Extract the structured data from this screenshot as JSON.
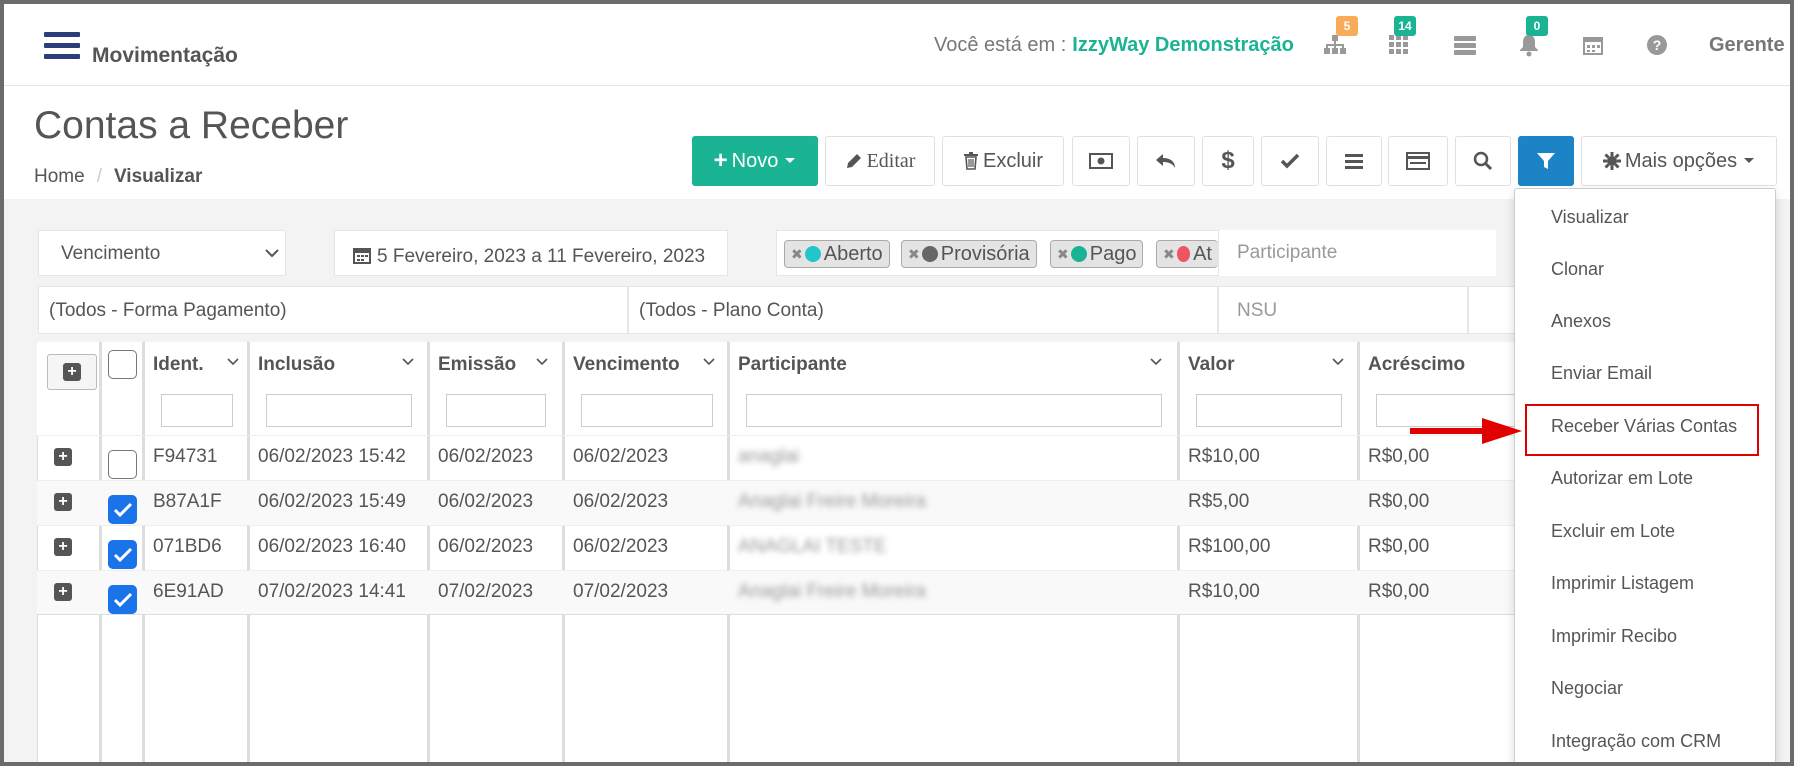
{
  "topbar": {
    "section_title": "Movimentação",
    "you_are_label": "Você está em :",
    "company": "IzzyWay Demonstração",
    "badges": {
      "org": "5",
      "apps": "14",
      "bell": "0"
    },
    "user": "Gerente",
    "colors": {
      "accent": "#1ab394",
      "badge_orange": "#f8ac59",
      "badge_green": "#1ab394",
      "nav_dark": "#2c3e7a"
    }
  },
  "page": {
    "title": "Contas a Receber",
    "breadcrumb": {
      "home": "Home",
      "sep": "/",
      "current": "Visualizar"
    }
  },
  "toolbar": {
    "novo": "Novo",
    "editar": "Editar",
    "excluir": "Excluir",
    "mais_opcoes": "Mais opções",
    "icons": [
      "money-icon",
      "undo-icon",
      "dollar-icon",
      "check-icon",
      "list-icon",
      "card-icon",
      "search-icon",
      "filter-icon"
    ]
  },
  "filters": {
    "date_type": "Vencimento",
    "date_range": "5 Fevereiro, 2023 a 11 Fevereiro, 2023",
    "status_chips": [
      "Aberto",
      "Provisória",
      "Pago",
      "At"
    ],
    "participante_placeholder": "Participante",
    "forma_pagamento": "(Todos - Forma Pagamento)",
    "plano_conta": "(Todos - Plano Conta)",
    "nsu_placeholder": "NSU"
  },
  "table": {
    "headers": [
      "Ident.",
      "Inclusão",
      "Emissão",
      "Vencimento",
      "Participante",
      "Valor",
      "Acréscimo"
    ],
    "rows": [
      {
        "id": "F94731",
        "inclusao": "06/02/2023 15:42",
        "emissao": "06/02/2023",
        "vencimento": "06/02/2023",
        "participante": "anaglai",
        "valor": "R$10,00",
        "acrescimo": "R$0,00",
        "checked": false
      },
      {
        "id": "B87A1F",
        "inclusao": "06/02/2023 15:49",
        "emissao": "06/02/2023",
        "vencimento": "06/02/2023",
        "participante": "Anaglai Freire Moreira",
        "valor": "R$5,00",
        "acrescimo": "R$0,00",
        "checked": true
      },
      {
        "id": "071BD6",
        "inclusao": "06/02/2023 16:40",
        "emissao": "06/02/2023",
        "vencimento": "06/02/2023",
        "participante": "ANAGLAI TESTE",
        "valor": "R$100,00",
        "acrescimo": "R$0,00",
        "checked": true
      },
      {
        "id": "6E91AD",
        "inclusao": "07/02/2023 14:41",
        "emissao": "07/02/2023",
        "vencimento": "07/02/2023",
        "participante": "Anaglai Freire Moreira",
        "valor": "R$10,00",
        "acrescimo": "R$0,00",
        "checked": true
      }
    ]
  },
  "menu": {
    "items": [
      "Visualizar",
      "Clonar",
      "Anexos",
      "Enviar Email",
      "Receber Várias Contas",
      "Autorizar em Lote",
      "Excluir em Lote",
      "Imprimir Listagem",
      "Imprimir Recibo",
      "Negociar",
      "Integração com CRM"
    ],
    "highlighted": "Receber Várias Contas"
  }
}
